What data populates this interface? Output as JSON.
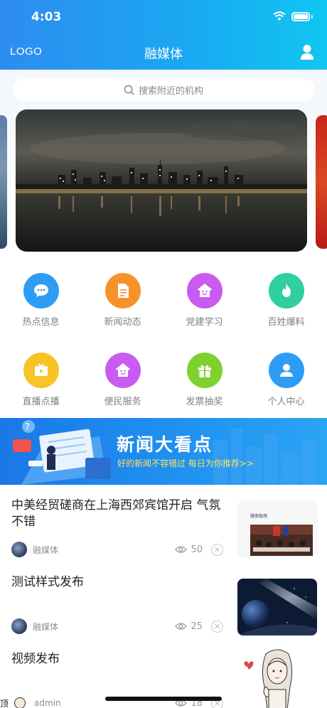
{
  "status": {
    "time": "4:03"
  },
  "header": {
    "logo": "LOGO",
    "title": "融媒体"
  },
  "search": {
    "placeholder": "搜索附近的机构"
  },
  "grid": [
    {
      "label": "热点信息",
      "icon": "chat-bubble-icon",
      "color": "#2d9cf5"
    },
    {
      "label": "新闻动态",
      "icon": "document-icon",
      "color": "#f7922a"
    },
    {
      "label": "党建学习",
      "icon": "house-smile-icon",
      "color": "#c95bf0"
    },
    {
      "label": "百姓爆料",
      "icon": "flame-icon",
      "color": "#2fcfa0"
    },
    {
      "label": "直播点播",
      "icon": "tv-icon",
      "color": "#f7c425"
    },
    {
      "label": "便民服务",
      "icon": "house-smile-icon",
      "color": "#c95bf0"
    },
    {
      "label": "发票抽奖",
      "icon": "gift-icon",
      "color": "#7ed12e"
    },
    {
      "label": "个人中心",
      "icon": "person-icon",
      "color": "#2d9cf5"
    }
  ],
  "promo": {
    "title": "新闻大看点",
    "subtitle": "好的新闻不容错过 每日为你推荐>>"
  },
  "news": [
    {
      "title": "中美经贸磋商在上海西郊宾馆开启 气氛不错",
      "source": "融媒体",
      "views": "50",
      "thumb_caption": "磋商现场"
    },
    {
      "title": "测试样式发布",
      "source": "融媒体",
      "views": "25"
    },
    {
      "title": "视频发布",
      "source": "admin",
      "views": "18",
      "prefix": "顶"
    }
  ]
}
